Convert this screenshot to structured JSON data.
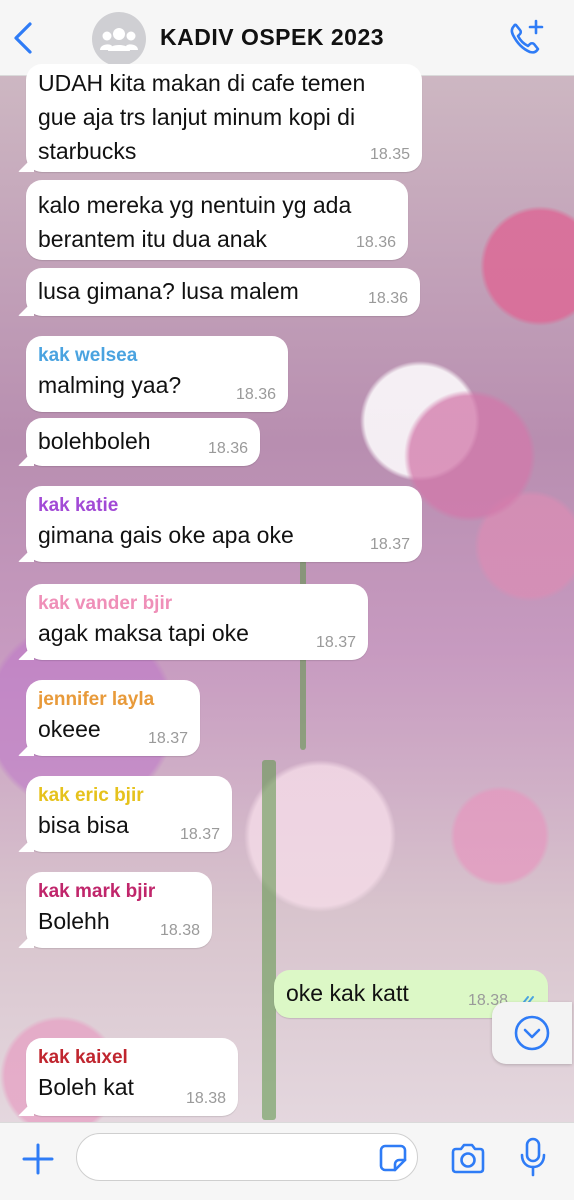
{
  "header": {
    "title": "KADIV OSPEK 2023"
  },
  "messages": [
    {
      "sender": "",
      "text": "UDAH kita makan di cafe temen\ngue aja trs lanjut minum kopi di\nstarbucks",
      "time": "18.35"
    },
    {
      "sender": "",
      "text": "kalo mereka yg nentuin yg ada\nberantem itu dua anak",
      "time": "18.36"
    },
    {
      "sender": "",
      "text": "lusa gimana? lusa malem",
      "time": "18.36"
    },
    {
      "sender": "kak welsea",
      "sender_color": "#4aa3e0",
      "text": "malming yaa?",
      "time": "18.36"
    },
    {
      "sender": "",
      "text": "bolehboleh",
      "time": "18.36"
    },
    {
      "sender": "kak katie",
      "sender_color": "#a24ad6",
      "text": "gimana gais oke apa oke",
      "time": "18.37"
    },
    {
      "sender": "kak vander bjir",
      "sender_color": "#ef8fb8",
      "text": "agak maksa tapi oke",
      "time": "18.37"
    },
    {
      "sender": "jennifer layla",
      "sender_color": "#e89a3a",
      "text": "okeee",
      "time": "18.37"
    },
    {
      "sender": "kak eric bjir",
      "sender_color": "#e6c21c",
      "text": "bisa bisa",
      "time": "18.37"
    },
    {
      "sender": "kak mark bjir",
      "sender_color": "#c0266b",
      "text": "Bolehh",
      "time": "18.38"
    },
    {
      "sender": "",
      "text": "oke kak katt",
      "time": "18.38",
      "outgoing": true
    },
    {
      "sender": "kak kaixel",
      "sender_color": "#c0262f",
      "text": "Boleh kat",
      "time": "18.38"
    }
  ],
  "composer": {
    "value": "",
    "placeholder": ""
  },
  "icons": {
    "back": "chevron-left-icon",
    "avatar": "group-icon",
    "call": "add-call-icon",
    "scroll": "chevron-down-circle-icon",
    "plus": "plus-icon",
    "sticker": "sticker-icon",
    "camera": "camera-icon",
    "mic": "mic-icon"
  },
  "colors": {
    "accent": "#2f7cf6",
    "outgoing_bubble": "#dcf8c6",
    "incoming_bubble": "#ffffff"
  }
}
